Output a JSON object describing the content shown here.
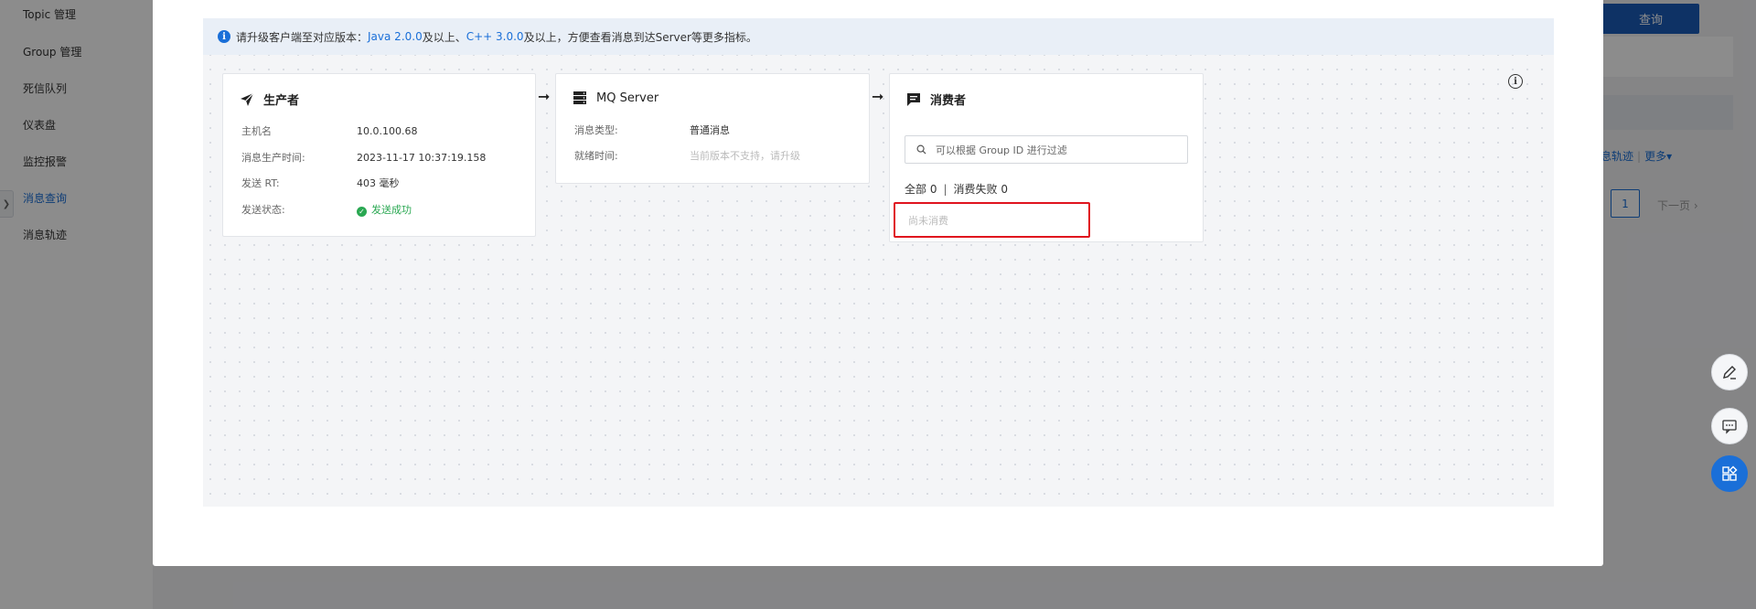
{
  "sidebar": {
    "items": [
      {
        "label": "Topic 管理"
      },
      {
        "label": "Group 管理"
      },
      {
        "label": "死信队列"
      },
      {
        "label": "仪表盘"
      },
      {
        "label": "监控报警"
      },
      {
        "label": "消息查询",
        "active": true
      },
      {
        "label": "消息轨迹"
      }
    ]
  },
  "background": {
    "query_button": "查询",
    "actions": [
      "息轨迹",
      "更多▾"
    ],
    "pager": {
      "current": "1",
      "next": "下一页"
    }
  },
  "notice": {
    "prefix": "请升级客户端至对应版本：",
    "java": "Java 2.0.0",
    "mid1": "及以上、",
    "cpp": "C++ 3.0.0",
    "suffix": "及以上，方便查看消息到达Server等更多指标。"
  },
  "producer": {
    "title": "生产者",
    "icon": "send-icon",
    "fields": [
      {
        "key": "主机名",
        "value": "10.0.100.68"
      },
      {
        "key": "消息生产时间:",
        "value": "2023-11-17 10:37:19.158"
      },
      {
        "key": "发送 RT:",
        "value": "403 毫秒"
      },
      {
        "key": "发送状态:",
        "value": "发送成功"
      }
    ]
  },
  "server": {
    "title": "MQ Server",
    "icon": "server-icon",
    "fields": [
      {
        "key": "消息类型:",
        "value": "普通消息"
      },
      {
        "key": "就绪时间:",
        "value": "当前版本不支持，请升级"
      }
    ]
  },
  "consumer": {
    "title": "消费者",
    "icon": "message-icon",
    "filter_placeholder": "可以根据 Group ID 进行过滤",
    "count_all": "全部 0",
    "count_failed": "消费失败 0",
    "empty_text": "尚未消费"
  },
  "colors": {
    "accent": "#1a6fd8",
    "success": "#2aa852",
    "highlight": "#e0141e"
  }
}
